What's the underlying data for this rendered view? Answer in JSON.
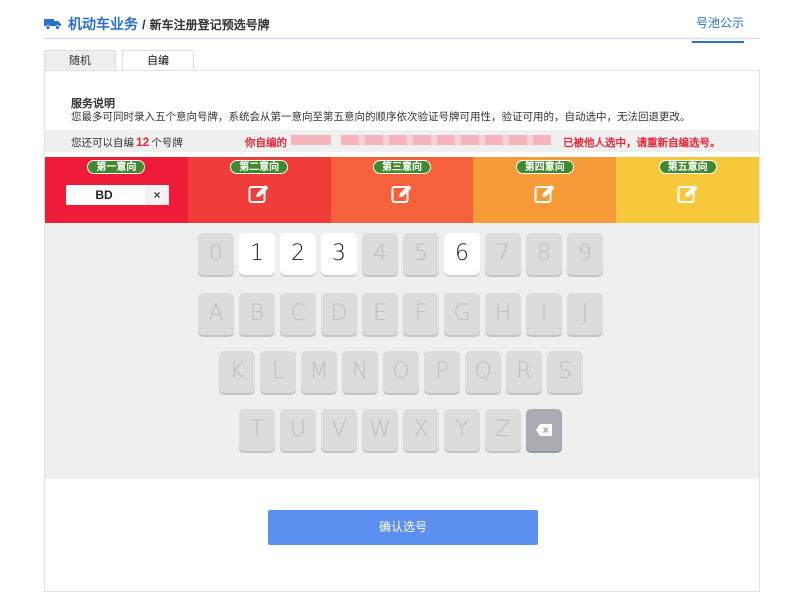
{
  "header": {
    "section": "机动车业务",
    "separator": "/",
    "page": "新车注册登记预选号牌",
    "pool_link": "号池公示"
  },
  "tabs": [
    {
      "label": "随机",
      "active": false
    },
    {
      "label": "自编",
      "active": true
    }
  ],
  "service": {
    "title": "服务说明",
    "description": "您最多可同时录入五个意向号牌，系统会从第一意向至第五意向的顺序依次验证号牌可用性，验证可用的，自动选中，无法回退更改。"
  },
  "info": {
    "remain_prefix": "您还可以自编",
    "remain_count": "12",
    "remain_suffix": "个号牌",
    "warn_prefix": "你自编的",
    "warn_suffix": "已被他人选中，请重新自编选号。"
  },
  "choices": [
    {
      "label": "第一意向",
      "value": "BD",
      "clear": "×",
      "color": "#ee1c38"
    },
    {
      "label": "第二意向",
      "value": "",
      "color": "#f03d3a"
    },
    {
      "label": "第三意向",
      "value": "",
      "color": "#f4613b"
    },
    {
      "label": "第四意向",
      "value": "",
      "color": "#f79a38"
    },
    {
      "label": "第五意向",
      "value": "",
      "color": "#f8c83c"
    }
  ],
  "keyboard": {
    "rows": [
      [
        "0",
        "1",
        "2",
        "3",
        "4",
        "5",
        "6",
        "7",
        "8",
        "9"
      ],
      [
        "A",
        "B",
        "C",
        "D",
        "E",
        "F",
        "G",
        "H",
        "I",
        "J"
      ],
      [
        "K",
        "L",
        "M",
        "N",
        "O",
        "P",
        "Q",
        "R",
        "S"
      ],
      [
        "T",
        "U",
        "V",
        "W",
        "X",
        "Y",
        "Z"
      ]
    ],
    "enabled": [
      "1",
      "2",
      "3",
      "6"
    ],
    "backspace_icon": "backspace-icon"
  },
  "confirm_label": "确认选号",
  "colors": {
    "accent": "#2a6fc9",
    "button": "#5b8ff0",
    "warning": "#e8283b",
    "pill": "#3e8a2c"
  }
}
